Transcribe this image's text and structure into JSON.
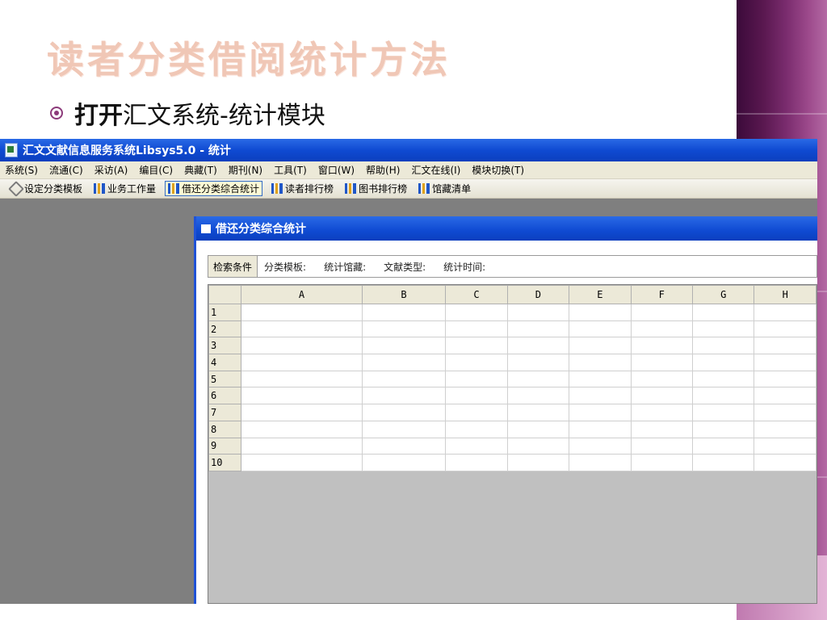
{
  "slide": {
    "title": "读者分类借阅统计方法",
    "bullet_bold": "打开",
    "bullet_text": "汇文系统-统计模块"
  },
  "window": {
    "title": "汇文文献信息服务系统Libsys5.0 - 统计",
    "menu": [
      "系统(S)",
      "流通(C)",
      "采访(A)",
      "编目(C)",
      "典藏(T)",
      "期刊(N)",
      "工具(T)",
      "窗口(W)",
      "帮助(H)",
      "汇文在线(I)",
      "模块切换(T)"
    ],
    "toolbar": [
      "设定分类模板",
      "业务工作量",
      "借还分类综合统计",
      "读者排行榜",
      "图书排行榜",
      "馆藏清单"
    ]
  },
  "child_window": {
    "title": "借还分类综合统计",
    "criteria_label": "检索条件",
    "criteria": [
      "分类模板:",
      "统计馆藏:",
      "文献类型:",
      "统计时间:"
    ]
  },
  "grid": {
    "columns": [
      "A",
      "B",
      "C",
      "D",
      "E",
      "F",
      "G",
      "H"
    ],
    "rows": [
      "1",
      "2",
      "3",
      "4",
      "5",
      "6",
      "7",
      "8",
      "9",
      "10"
    ]
  },
  "colors": {
    "title_bar": "#0f4ad2",
    "slide_title": "#f0c7b6",
    "accent": "#8c3a7a"
  }
}
